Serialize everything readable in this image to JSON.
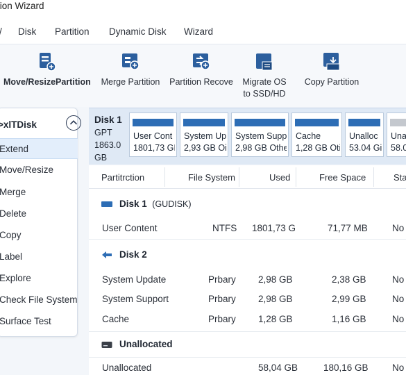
{
  "window": {
    "title": "tion Wizard"
  },
  "menu": [
    "Disk",
    "Partition",
    "Dynamic Disk",
    "Wizard"
  ],
  "toolbar": [
    {
      "icon": "move-resize-icon",
      "label": "Move/ResizePartition"
    },
    {
      "icon": "merge-partition-icon",
      "label": "Merge Partition"
    },
    {
      "icon": "partition-recover-icon",
      "label": "Partition Recove"
    },
    {
      "icon": "migrate-os-icon",
      "label": "Migrate OS",
      "label2": "to SSD/HD"
    },
    {
      "icon": "copy-partition-icon",
      "label": "Copy Partition"
    }
  ],
  "sidebar": {
    "title": ">xlTDisk",
    "items": [
      "Extend",
      "Move/Resize",
      "Merge",
      "Delete",
      "Copy",
      "Label",
      "Explore",
      "Check File System",
      "Surface Test"
    ]
  },
  "diskmap": {
    "name": "Disk 1",
    "type": "GPT",
    "size": "1863.0",
    "unit": "GB",
    "partitions": [
      {
        "name": "User Cont",
        "detail": "1801,73 GI"
      },
      {
        "name": "System Up",
        "detail": "2,93 GB Oi"
      },
      {
        "name": "System Supp",
        "detail": "2,98 GB Othe"
      },
      {
        "name": "Cache",
        "detail": "1,28 GB Oti"
      },
      {
        "name": "Unalloc",
        "detail": "53.04 Gi"
      },
      {
        "name": "Una",
        "detail": "58.0"
      }
    ]
  },
  "table": {
    "columns": [
      "Partitrction",
      "File System",
      "Used",
      "Free Space",
      "Sta"
    ],
    "groups": [
      {
        "name": "Disk 1",
        "sub": "(GUDISK)",
        "rows": [
          {
            "name": "User Content",
            "fs": "NTFS",
            "used": "1801,73 G",
            "free": "71,77 MB",
            "status": "No"
          }
        ]
      },
      {
        "name": "Disk 2",
        "sub": "",
        "rows": [
          {
            "name": "System Update",
            "fs": "Prbary",
            "used": "2,98 GB",
            "free": "2,38  GB",
            "status": "No"
          },
          {
            "name": "System Support",
            "fs": "Prbary",
            "used": "2,98 GB",
            "free": "2,99  GB",
            "status": "No"
          },
          {
            "name": "Cache",
            "fs": "Prbary",
            "used": "1,28 GB",
            "free": "1,16  GB",
            "status": "No"
          }
        ]
      },
      {
        "name": "Unallocated",
        "sub": "",
        "rows": [
          {
            "name": "Unallocated",
            "fs": "",
            "used": "58,04 GB",
            "free": "180,16  GB",
            "status": "No"
          }
        ]
      }
    ]
  },
  "colors": {
    "accent": "#2d6db5",
    "selection": "#e3eefb",
    "diskmap_bg": "#dfe9f5"
  }
}
